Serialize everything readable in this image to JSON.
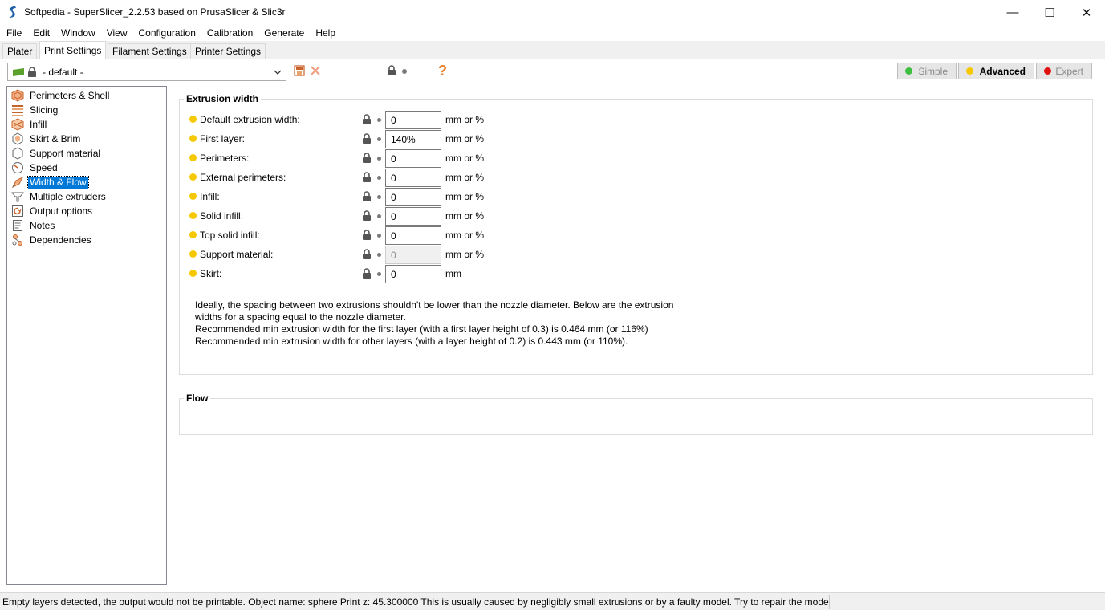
{
  "window": {
    "title": "Softpedia - SuperSlicer_2.2.53 based on PrusaSlicer & Slic3r",
    "minimize": "—",
    "maximize": "☐",
    "close": "✕"
  },
  "menu": [
    "File",
    "Edit",
    "Window",
    "View",
    "Configuration",
    "Calibration",
    "Generate",
    "Help"
  ],
  "tabs": [
    {
      "label": "Plater",
      "active": false
    },
    {
      "label": "Print Settings",
      "active": true
    },
    {
      "label": "Filament Settings",
      "active": false
    },
    {
      "label": "Printer Settings",
      "active": false
    }
  ],
  "toolbar": {
    "preset_value": "- default -",
    "help_symbol": "?"
  },
  "modes": [
    {
      "label": "Simple",
      "color": "#3fbf3f",
      "active": false
    },
    {
      "label": "Advanced",
      "color": "#f5c800",
      "active": true
    },
    {
      "label": "Expert",
      "color": "#e01010",
      "active": false
    }
  ],
  "sidebar": {
    "items": [
      {
        "label": "Perimeters & Shell",
        "icon": "perimeters-icon"
      },
      {
        "label": "Slicing",
        "icon": "slicing-icon"
      },
      {
        "label": "Infill",
        "icon": "infill-icon"
      },
      {
        "label": "Skirt & Brim",
        "icon": "skirt-icon"
      },
      {
        "label": "Support material",
        "icon": "support-icon"
      },
      {
        "label": "Speed",
        "icon": "speed-icon"
      },
      {
        "label": "Width & Flow",
        "icon": "width-flow-icon"
      },
      {
        "label": "Multiple extruders",
        "icon": "extruders-icon"
      },
      {
        "label": "Output options",
        "icon": "output-icon"
      },
      {
        "label": "Notes",
        "icon": "notes-icon"
      },
      {
        "label": "Dependencies",
        "icon": "dependencies-icon"
      }
    ],
    "selected_index": 6
  },
  "extrusion": {
    "title": "Extrusion width",
    "fields": [
      {
        "label": "Default extrusion width:",
        "value": "0",
        "unit": "mm or %",
        "disabled": false
      },
      {
        "label": "First layer:",
        "value": "140%",
        "unit": "mm or %",
        "disabled": false
      },
      {
        "label": "Perimeters:",
        "value": "0",
        "unit": "mm or %",
        "disabled": false
      },
      {
        "label": "External perimeters:",
        "value": "0",
        "unit": "mm or %",
        "disabled": false
      },
      {
        "label": "Infill:",
        "value": "0",
        "unit": "mm or %",
        "disabled": false
      },
      {
        "label": "Solid infill:",
        "value": "0",
        "unit": "mm or %",
        "disabled": false
      },
      {
        "label": "Top solid infill:",
        "value": "0",
        "unit": "mm or %",
        "disabled": false
      },
      {
        "label": "Support material:",
        "value": "0",
        "unit": "mm or %",
        "disabled": true
      },
      {
        "label": "Skirt:",
        "value": "0",
        "unit": "mm",
        "disabled": false
      }
    ],
    "info": [
      "Ideally, the spacing between two extrusions shouldn't be lower than the nozzle diameter. Below are the extrusion",
      "widths for a spacing equal to the nozzle diameter.",
      "Recommended min extrusion width for the first layer (with a first layer height of 0.3) is 0.464 mm (or 116%)",
      "Recommended min extrusion width for other layers (with a layer height of 0.2) is 0.443 mm (or 110%)."
    ]
  },
  "flow": {
    "title": "Flow"
  },
  "status": {
    "message": "Empty layers detected, the output would not be printable.  Object name: sphere Print z: 45.300000  This is usually caused by negligibly small extrusions or by a faulty model. Try to repair the model or"
  }
}
